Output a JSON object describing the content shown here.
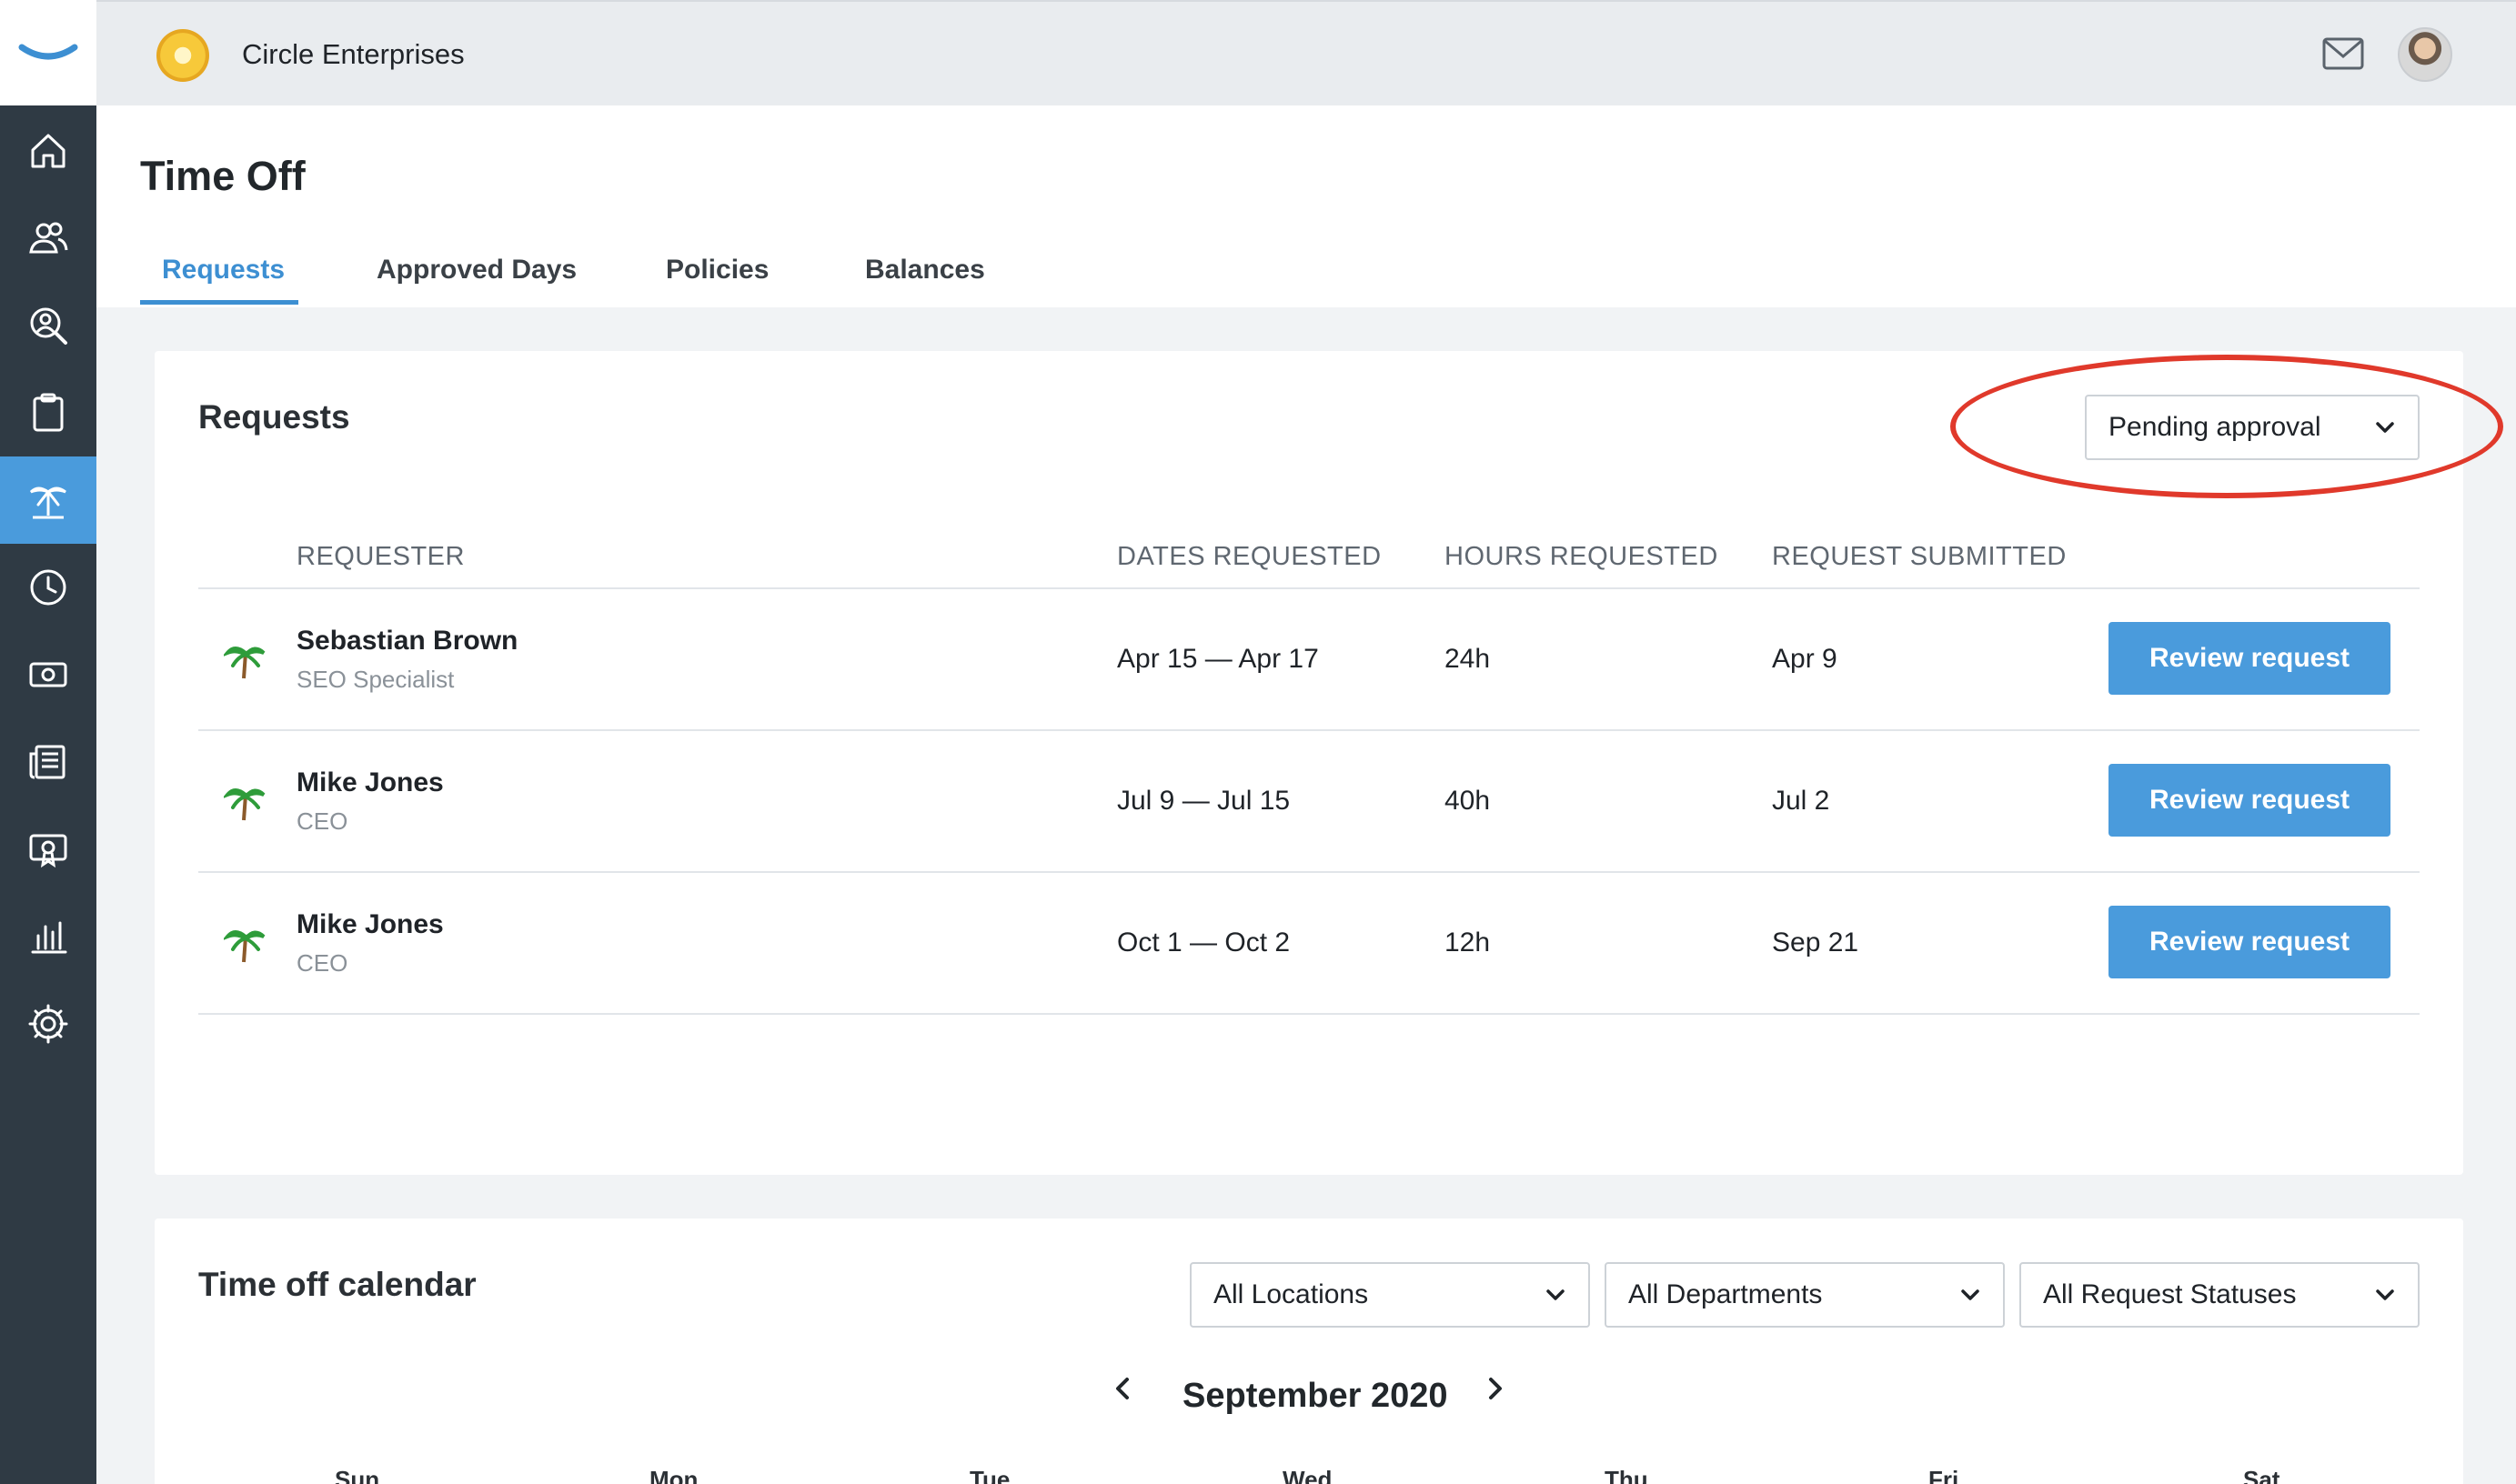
{
  "company": {
    "name": "Circle Enterprises"
  },
  "nav": {
    "items": [
      {
        "icon": "home-icon"
      },
      {
        "icon": "people-icon"
      },
      {
        "icon": "search-person-icon"
      },
      {
        "icon": "clipboard-icon"
      },
      {
        "icon": "palm-tree-icon",
        "active": true
      },
      {
        "icon": "clock-icon"
      },
      {
        "icon": "money-icon"
      },
      {
        "icon": "news-icon"
      },
      {
        "icon": "certificate-icon"
      },
      {
        "icon": "bar-chart-icon"
      },
      {
        "icon": "gear-icon"
      }
    ]
  },
  "page": {
    "title": "Time Off"
  },
  "tabs": [
    {
      "label": "Requests",
      "active": true
    },
    {
      "label": "Approved Days"
    },
    {
      "label": "Policies"
    },
    {
      "label": "Balances"
    }
  ],
  "requests_card": {
    "title": "Requests",
    "filter": {
      "selected": "Pending approval"
    },
    "columns": [
      "REQUESTER",
      "DATES REQUESTED",
      "HOURS REQUESTED",
      "REQUEST SUBMITTED"
    ],
    "rows": [
      {
        "name": "Sebastian Brown",
        "role": "SEO Specialist",
        "dates": "Apr 15 — Apr 17",
        "hours": "24h",
        "submitted": "Apr 9",
        "action": "Review request"
      },
      {
        "name": "Mike Jones",
        "role": "CEO",
        "dates": "Jul 9 — Jul 15",
        "hours": "40h",
        "submitted": "Jul 2",
        "action": "Review request"
      },
      {
        "name": "Mike Jones",
        "role": "CEO",
        "dates": "Oct 1 — Oct 2",
        "hours": "12h",
        "submitted": "Sep 21",
        "action": "Review request"
      }
    ]
  },
  "calendar_card": {
    "title": "Time off calendar",
    "filters": [
      "All Locations",
      "All Departments",
      "All Request Statuses"
    ],
    "month": "September 2020",
    "days": [
      "Sun",
      "Mon",
      "Tue",
      "Wed",
      "Thu",
      "Fri",
      "Sat"
    ]
  },
  "colors": {
    "accent": "#4a9bdc",
    "sidebar": "#2f3a44",
    "annotation": "#e0392b"
  }
}
